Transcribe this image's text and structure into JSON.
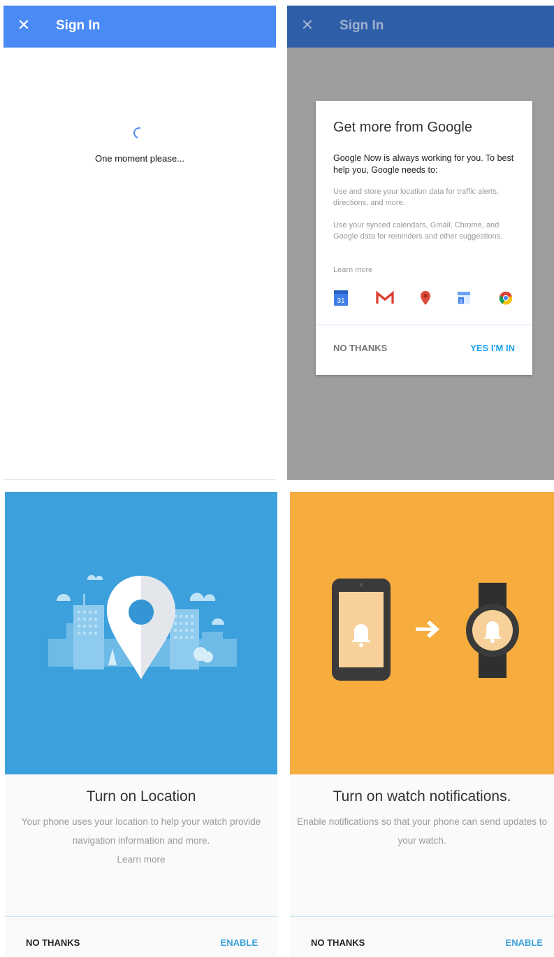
{
  "sign_in": {
    "title": "Sign In",
    "close_icon": "close-icon",
    "loading_text": "One moment please...",
    "accent": "#4a8af4"
  },
  "google_dialog": {
    "appbar_title": "Sign In",
    "title": "Get more from Google",
    "intro": "Google Now is always working for you. To best help you, Google needs to:",
    "items": [
      "Use and store your location data for traffic alerts, directions, and more.",
      "Use your synced calendars, Gmail, Chrome, and Google data for reminders and other suggestions."
    ],
    "learn_more": "Learn more",
    "icons": [
      "calendar-icon",
      "gmail-icon",
      "maps-pin-icon",
      "calendar-alt-icon",
      "chrome-icon"
    ],
    "calendar_number": "31",
    "alt_calendar_number": "8",
    "no_thanks": "NO THANKS",
    "yes": "YES I'M IN",
    "accent": "#1da1f2"
  },
  "location": {
    "title": "Turn on Location",
    "body": "Your phone uses your location to help your watch provide navigation information and more.",
    "learn_more": "Learn more",
    "no_thanks": "NO THANKS",
    "enable": "ENABLE",
    "hero_color": "#3ca0dc"
  },
  "watch": {
    "title": "Turn on watch notifications.",
    "body": "Enable notifications so that your phone can send updates to your watch.",
    "no_thanks": "NO THANKS",
    "enable": "ENABLE",
    "hero_color": "#f7ac3e"
  }
}
